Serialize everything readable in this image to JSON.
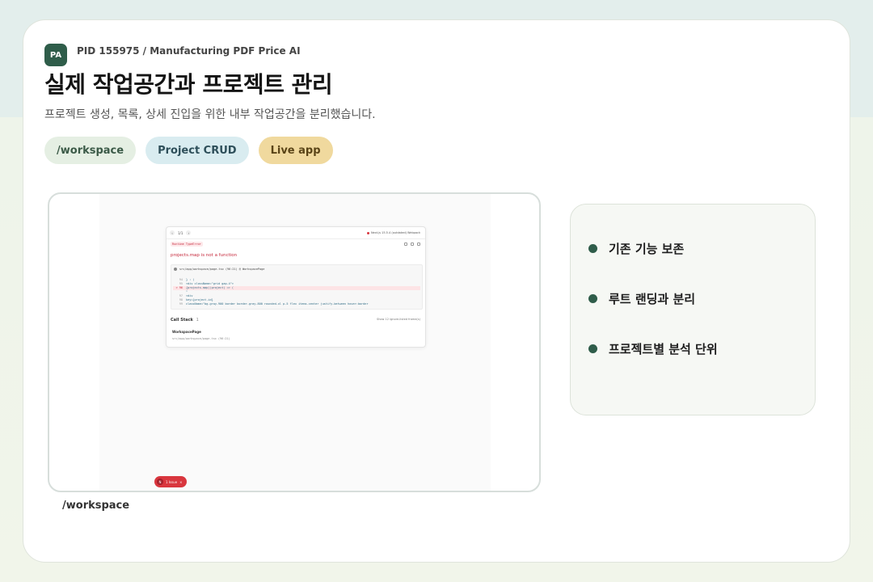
{
  "header": {
    "avatar": "PA",
    "pid": "PID 155975 / Manufacturing PDF Price AI",
    "title": "실제 작업공간과 프로젝트 관리",
    "subtitle": "프로젝트 생성, 목록, 상세 진입을 위한 내부 작업공간을 분리했습니다."
  },
  "tags": [
    "/workspace",
    "Project CRUD",
    "Live app"
  ],
  "screenshot": {
    "nav_count": "1/1",
    "version": "Next.js 15.5.4 (outdated) Webpack",
    "error_type": "Runtime TypeError",
    "error_message": "projects.map is not a function",
    "code_file": "src/app/workspace/page.tsx (96:21) @ WorkspacePage",
    "code_lines": [
      {
        "num": "94",
        "text": "    } : ("
      },
      {
        "num": "95",
        "text": "      <div className=\"grid gap-4\">"
      },
      {
        "num": "> 96",
        "text": "        {projects.map((project) => ("
      },
      {
        "num": "",
        "text": "                  ^"
      },
      {
        "num": "97",
        "text": "          <div"
      },
      {
        "num": "98",
        "text": "            key={project.id}"
      },
      {
        "num": "99",
        "text": "            className=\"bg-gray-900 border border-gray-800 rounded-xl p-5 flex items-center justify-between hover:border"
      }
    ],
    "call_stack_label": "Call Stack",
    "call_stack_count": "1",
    "ignore_toggle": "Show 12 ignore-listed frame(s)",
    "frame_name": "WorkspacePage",
    "frame_path": "src/app/workspace/page.tsx (96:21)",
    "issue_badge": "N",
    "issue_text": "1 Issue"
  },
  "caption": "/workspace",
  "features": [
    "기존 기능 보존",
    "루트 랜딩과 분리",
    "프로젝트별 분석 단위"
  ],
  "colors": {
    "accent": "#2f5d4a",
    "error": "#d9363e"
  }
}
